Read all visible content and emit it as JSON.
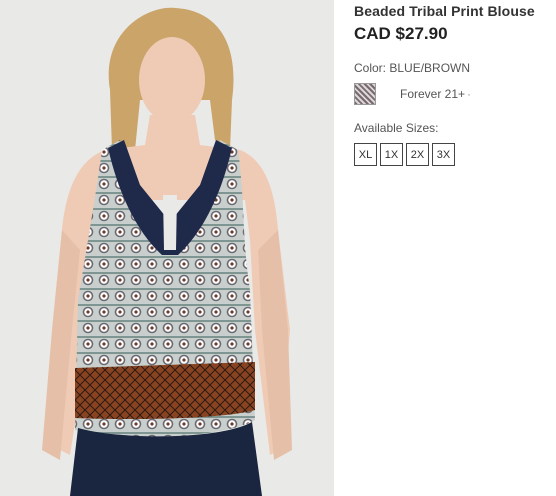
{
  "product": {
    "title": "Beaded Tribal Print Blouse",
    "price": "CAD $27.90",
    "color_label": "Color:",
    "color_value": "BLUE/BROWN",
    "brand": "Forever 21+",
    "brand_suffix": "·",
    "sizes_label": "Available Sizes:",
    "sizes": [
      "XL",
      "1X",
      "2X",
      "3X"
    ],
    "image_alt": "Model wearing beaded tribal print blouse"
  },
  "colors": {
    "background": "#ffffff",
    "photo_bg": "#e9e9e7",
    "title": "#333333",
    "price": "#222222",
    "blouse_navy": "#1f2a4a",
    "blouse_rust": "#8a4320"
  }
}
